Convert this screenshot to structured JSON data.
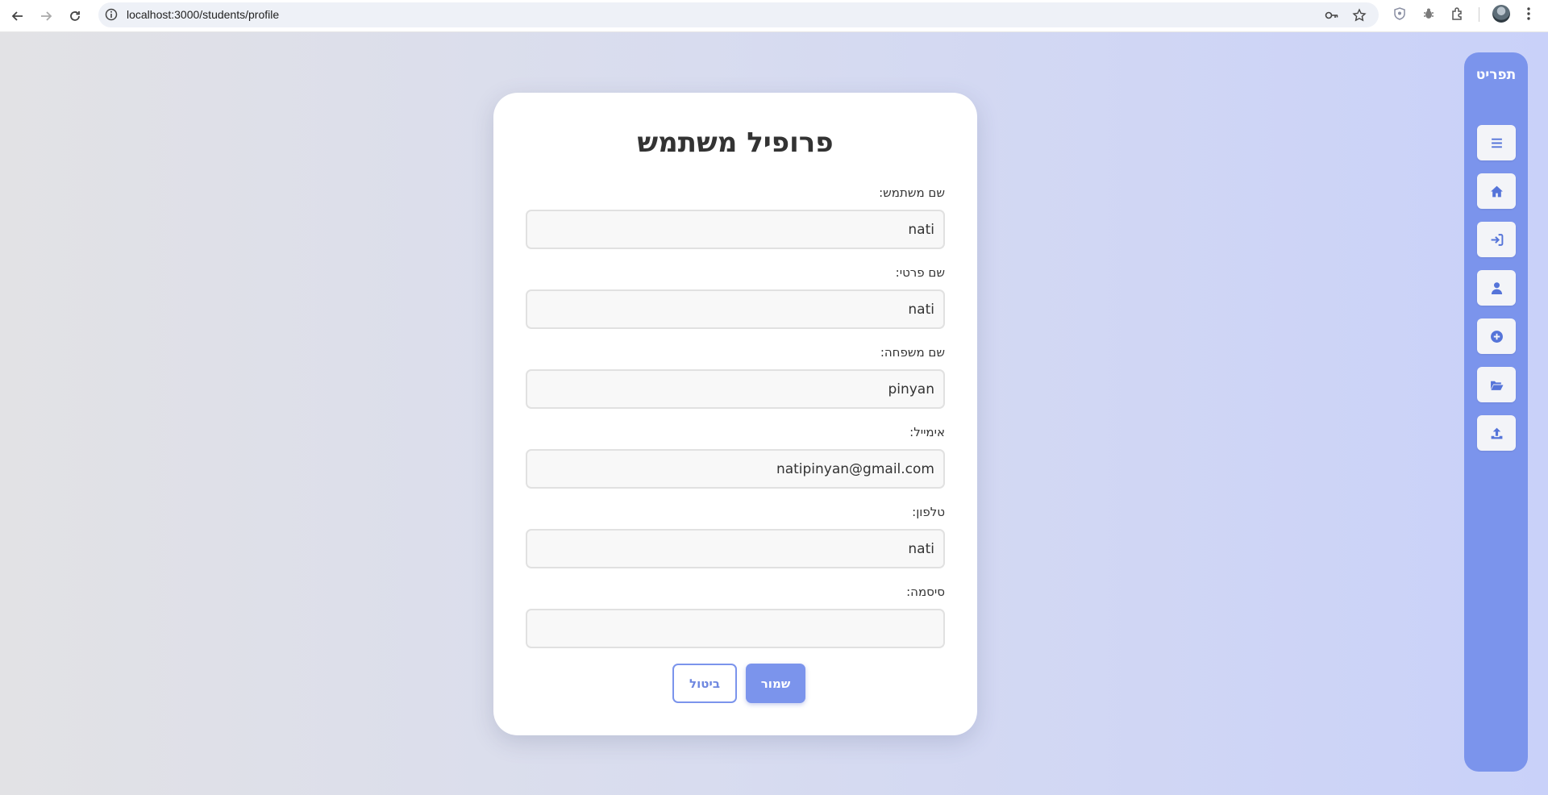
{
  "browser": {
    "url": "localhost:3000/students/profile"
  },
  "sidebar": {
    "title": "תפריט",
    "items": [
      {
        "icon": "menu-icon"
      },
      {
        "icon": "home-icon"
      },
      {
        "icon": "login-icon"
      },
      {
        "icon": "user-icon"
      },
      {
        "icon": "plus-circle-icon"
      },
      {
        "icon": "folder-open-icon"
      },
      {
        "icon": "upload-icon"
      }
    ]
  },
  "form": {
    "title": "פרופיל משתמש",
    "fields": [
      {
        "label": "שם משתמש:",
        "value": "nati"
      },
      {
        "label": "שם פרטי:",
        "value": "nati"
      },
      {
        "label": "שם משפחה:",
        "value": "pinyan"
      },
      {
        "label": "אימייל:",
        "value": "natipinyan@gmail.com"
      },
      {
        "label": "טלפון:",
        "value": "nati"
      },
      {
        "label": "סיסמה:",
        "value": ""
      }
    ],
    "save_label": "שמור",
    "cancel_label": "ביטול"
  },
  "colors": {
    "accent": "#7b94ec",
    "background_left": "#e2e2e5",
    "background_right": "#c9d1f9"
  }
}
